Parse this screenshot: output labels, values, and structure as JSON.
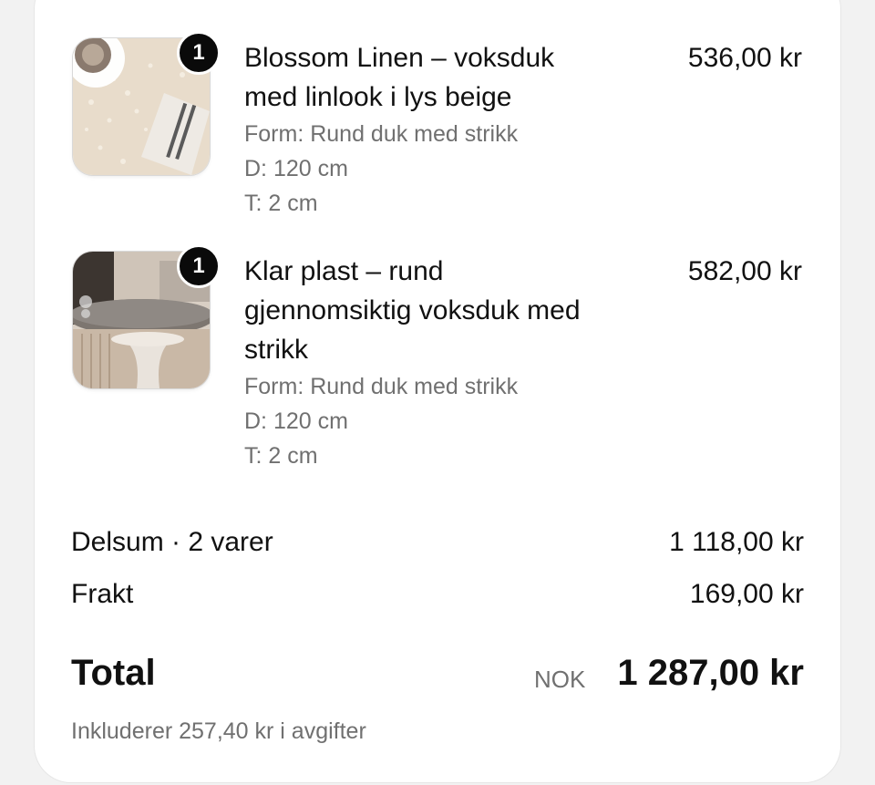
{
  "cart": {
    "items": [
      {
        "quantity": "1",
        "name_line1": "Blossom Linen – voksduk",
        "name_line2": "med linlook i lys beige",
        "name_line3": "",
        "form": "Form: Rund duk med strikk",
        "diameter": "D: 120 cm",
        "thickness": "T: 2 cm",
        "price": "536,00 kr"
      },
      {
        "quantity": "1",
        "name_line1": "Klar plast – rund",
        "name_line2": "gjennomsiktig voksduk med",
        "name_line3": "strikk",
        "form": "Form: Rund duk med strikk",
        "diameter": "D: 120 cm",
        "thickness": "T: 2 cm",
        "price": "582,00 kr"
      }
    ]
  },
  "summary": {
    "subtotal_label": "Delsum · 2 varer",
    "subtotal_value": "1 118,00 kr",
    "shipping_label": "Frakt",
    "shipping_value": "169,00 kr",
    "total_label": "Total",
    "currency": "NOK",
    "total_value": "1 287,00 kr",
    "tax_note": "Inkluderer 257,40 kr i avgifter"
  }
}
